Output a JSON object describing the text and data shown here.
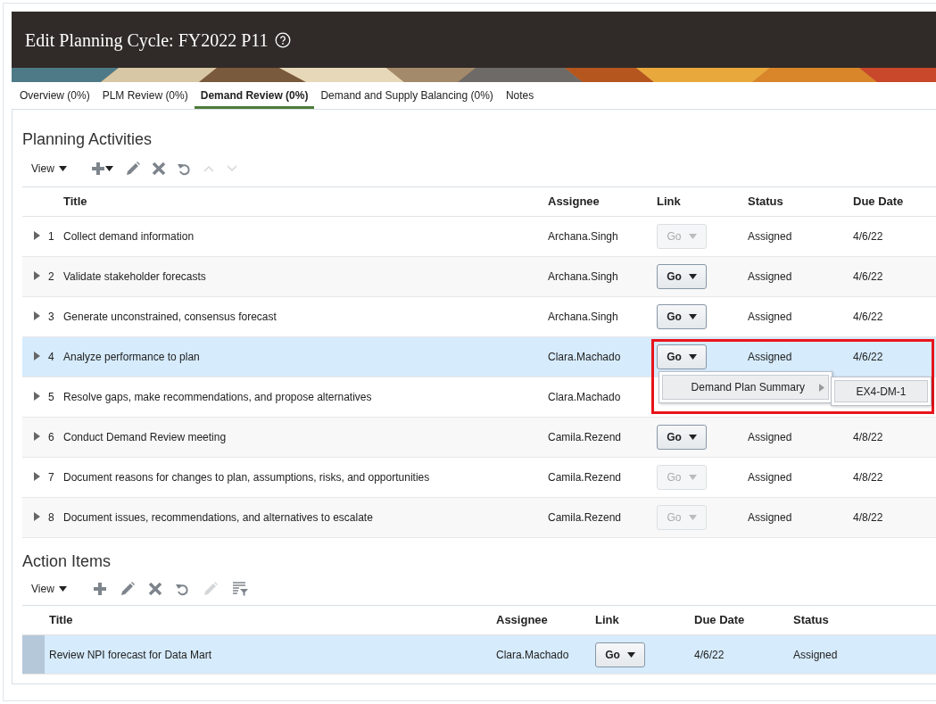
{
  "header": {
    "title": "Edit Planning Cycle: FY2022 P11"
  },
  "tabs": [
    {
      "label": "Overview (0%)",
      "selected": false
    },
    {
      "label": "PLM Review (0%)",
      "selected": false
    },
    {
      "label": "Demand Review (0%)",
      "selected": true
    },
    {
      "label": "Demand and Supply Balancing (0%)",
      "selected": false
    },
    {
      "label": "Notes",
      "selected": false
    }
  ],
  "planning_activities": {
    "title": "Planning Activities",
    "view_menu": "View",
    "tools": [
      {
        "kind": "add-menu",
        "disabled": false
      },
      {
        "kind": "edit",
        "disabled": false
      },
      {
        "kind": "delete",
        "disabled": false
      },
      {
        "kind": "refresh",
        "disabled": false
      },
      {
        "kind": "move-up",
        "disabled": true
      },
      {
        "kind": "move-down",
        "disabled": true
      }
    ],
    "columns": [
      "Title",
      "Assignee",
      "Link",
      "Status",
      "Due Date"
    ],
    "rows": [
      {
        "number": "1",
        "title": "Collect demand information",
        "assignee": "Archana.Singh",
        "link": {
          "label": "Go",
          "disabled": true
        },
        "status": "Assigned",
        "due_date": "4/6/22",
        "selected": false
      },
      {
        "number": "2",
        "title": "Validate stakeholder forecasts",
        "assignee": "Archana.Singh",
        "link": {
          "label": "Go",
          "disabled": false
        },
        "status": "Assigned",
        "due_date": "4/6/22",
        "selected": false
      },
      {
        "number": "3",
        "title": "Generate unconstrained, consensus forecast",
        "assignee": "Archana.Singh",
        "link": {
          "label": "Go",
          "disabled": false
        },
        "status": "Assigned",
        "due_date": "4/6/22",
        "selected": false
      },
      {
        "number": "4",
        "title": "Analyze performance to plan",
        "assignee": "Clara.Machado",
        "link": {
          "label": "Go",
          "disabled": false
        },
        "status": "Assigned",
        "due_date": "4/6/22",
        "selected": true
      },
      {
        "number": "5",
        "title": "Resolve gaps, make recommendations, and propose alternatives",
        "assignee": "Clara.Machado",
        "selected": false
      },
      {
        "number": "6",
        "title": "Conduct Demand Review meeting",
        "assignee": "Camila.Rezend",
        "link": {
          "label": "Go",
          "disabled": false
        },
        "status": "Assigned",
        "due_date": "4/8/22",
        "selected": false
      },
      {
        "number": "7",
        "title": "Document reasons for changes to plan, assumptions, risks, and opportunities",
        "assignee": "Camila.Rezend",
        "link": {
          "label": "Go",
          "disabled": true
        },
        "status": "Assigned",
        "due_date": "4/8/22",
        "selected": false
      },
      {
        "number": "8",
        "title": "Document issues, recommendations, and alternatives to escalate",
        "assignee": "Camila.Rezend",
        "link": {
          "label": "Go",
          "disabled": true
        },
        "status": "Assigned",
        "due_date": "4/8/22",
        "selected": false
      }
    ],
    "link_menu": {
      "item": "Demand Plan Summary",
      "submenu_item": "EX4-DM-1"
    }
  },
  "action_items": {
    "title": "Action Items",
    "view_menu": "View",
    "tools": [
      {
        "kind": "add",
        "disabled": false
      },
      {
        "kind": "edit",
        "disabled": false
      },
      {
        "kind": "delete",
        "disabled": false
      },
      {
        "kind": "refresh",
        "disabled": false
      },
      {
        "kind": "edit",
        "disabled": true
      },
      {
        "kind": "filter",
        "disabled": false
      }
    ],
    "columns": [
      "Title",
      "Assignee",
      "Link",
      "Due Date",
      "Status"
    ],
    "rows": [
      {
        "title": "Review NPI forecast for Data Mart",
        "assignee": "Clara.Machado",
        "link": {
          "label": "Go",
          "disabled": false
        },
        "due_date": "4/6/22",
        "status": "Assigned",
        "selected": true
      }
    ]
  }
}
